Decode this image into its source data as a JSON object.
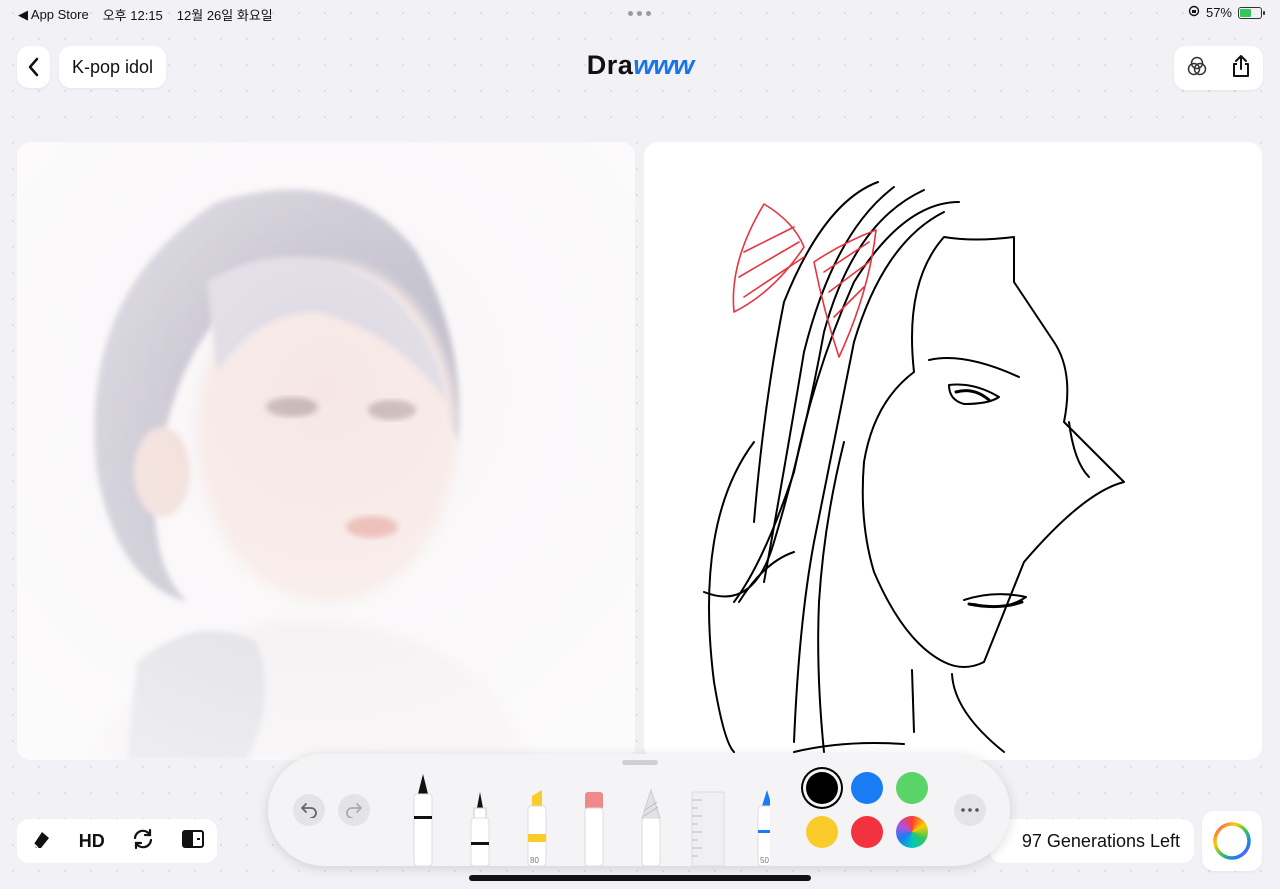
{
  "status_bar": {
    "back_app": "◀ App Store",
    "time": "오후 12:15",
    "date": "12월 26일 화요일",
    "battery_percent": "57%",
    "battery_level": 0.57
  },
  "header": {
    "back_icon": "chevron-left-icon",
    "prompt": "K-pop idol",
    "title_main": "Dra",
    "title_accent": "www",
    "right_icons": [
      "overlay-circles-icon",
      "share-icon"
    ]
  },
  "generated_image": {
    "subject": "ai-generated-portrait"
  },
  "sketch": {
    "stroke_colors": [
      "#000000",
      "#e8333f"
    ]
  },
  "toolbar": {
    "undo_icon": "undo-icon",
    "redo_icon": "redo-icon",
    "tools": [
      {
        "name": "pen",
        "label": ""
      },
      {
        "name": "fineliner",
        "label": ""
      },
      {
        "name": "marker",
        "label": "80"
      },
      {
        "name": "eraser",
        "label": ""
      },
      {
        "name": "pencil",
        "label": ""
      },
      {
        "name": "ruler",
        "label": ""
      },
      {
        "name": "crayon",
        "label": "50"
      }
    ],
    "colors": [
      "#000000",
      "#1a7cf5",
      "#5ad466",
      "#f9cc2b",
      "#f2333f",
      "spectrum"
    ],
    "selected_color": "#000000",
    "more_icon": "more-icon"
  },
  "bottom_left": {
    "eraser_icon": "eraser-icon",
    "hd_label": "HD",
    "refresh_icon": "refresh-icon",
    "compare_icon": "compare-icon"
  },
  "generations": {
    "text": "97 Generations Left"
  }
}
